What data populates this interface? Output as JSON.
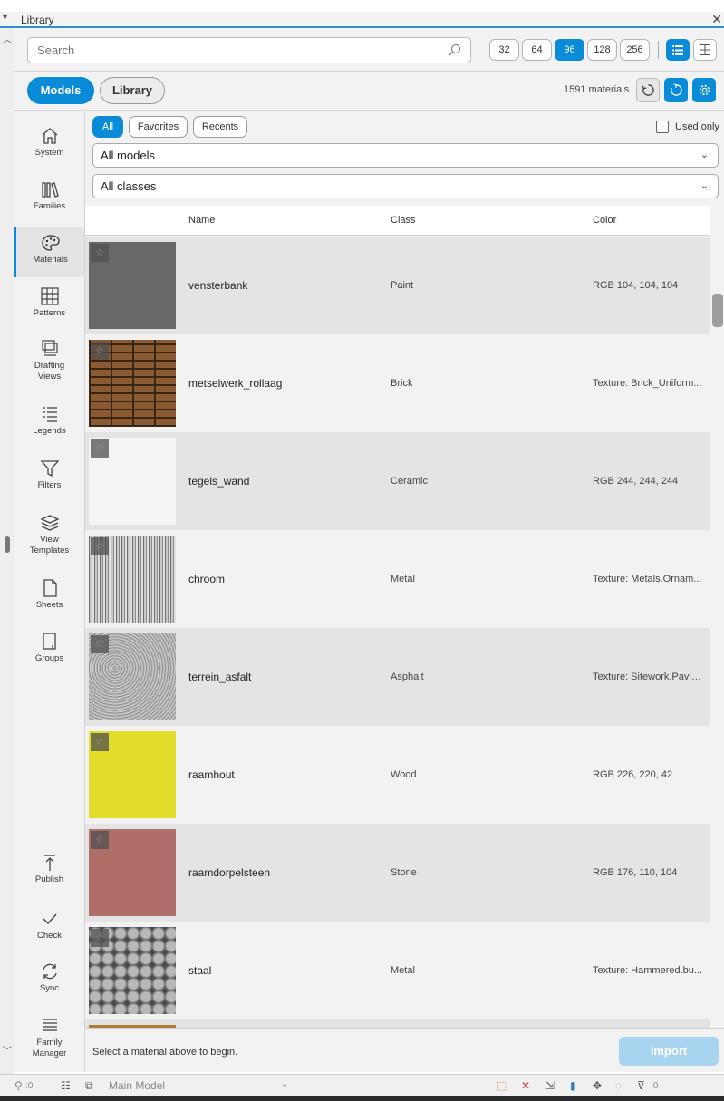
{
  "window": {
    "title": "Library",
    "close_glyph": "✕",
    "menu_glyph": "▾"
  },
  "search": {
    "placeholder": "Search",
    "value": ""
  },
  "sizes": [
    {
      "label": "32",
      "selected": false
    },
    {
      "label": "64",
      "selected": false
    },
    {
      "label": "96",
      "selected": true
    },
    {
      "label": "128",
      "selected": false
    },
    {
      "label": "256",
      "selected": false
    }
  ],
  "view_modes": [
    "list-view-icon",
    "grid-view-icon"
  ],
  "tabs": {
    "models": "Models",
    "library": "Library"
  },
  "material_count": "1591 materials",
  "sidebar": {
    "items": [
      {
        "label": "System",
        "icon": "home-icon"
      },
      {
        "label": "Families",
        "icon": "books-icon"
      },
      {
        "label": "Materials",
        "icon": "palette-icon",
        "selected": true
      },
      {
        "label": "Patterns",
        "icon": "grid-icon"
      },
      {
        "label": "Drafting Views",
        "icon": "drafting-views-icon"
      },
      {
        "label": "Legends",
        "icon": "legend-list-icon"
      },
      {
        "label": "Filters",
        "icon": "filter-icon"
      },
      {
        "label": "View Templates",
        "icon": "layers-icon"
      },
      {
        "label": "Sheets",
        "icon": "sheet-icon"
      },
      {
        "label": "Groups",
        "icon": "groups-icon"
      }
    ],
    "bottom": [
      {
        "label": "Publish",
        "icon": "publish-icon"
      },
      {
        "label": "Check",
        "icon": "check-icon"
      },
      {
        "label": "Sync",
        "icon": "sync-icon"
      },
      {
        "label": "Family Manager",
        "icon": "family-manager-icon"
      }
    ]
  },
  "filters": {
    "chips": [
      "All",
      "Favorites",
      "Recents"
    ],
    "used_only": "Used only",
    "models_dropdown": "All models",
    "classes_dropdown": "All classes"
  },
  "table": {
    "headers": {
      "name": "Name",
      "class": "Class",
      "color": "Color"
    },
    "rows": [
      {
        "name": "vensterbank",
        "class": "Paint",
        "color": "RGB 104, 104, 104",
        "swatch": "#686868",
        "texture": "none"
      },
      {
        "name": "metselwerk_rollaag",
        "class": "Brick",
        "color": "Texture: Brick_Uniform...",
        "swatch": "#8a5a32",
        "texture": "brick"
      },
      {
        "name": "tegels_wand",
        "class": "Ceramic",
        "color": "RGB 244, 244, 244",
        "swatch": "#f4f4f4",
        "texture": "none"
      },
      {
        "name": "chroom",
        "class": "Metal",
        "color": "Texture: Metals.Ornam...",
        "swatch": "#9a9a9a",
        "texture": "streak"
      },
      {
        "name": "terrein_asfalt",
        "class": "Asphalt",
        "color": "Texture: Sitework.Pavin...",
        "swatch": "#a8a8a8",
        "texture": "noise"
      },
      {
        "name": "raamhout",
        "class": "Wood",
        "color": "RGB 226, 220, 42",
        "swatch": "#e2dc2a",
        "texture": "none"
      },
      {
        "name": "raamdorpelsteen",
        "class": "Stone",
        "color": "RGB 176, 110, 104",
        "swatch": "#b06e68",
        "texture": "none"
      },
      {
        "name": "staal",
        "class": "Metal",
        "color": "Texture: Hammered.bu...",
        "swatch": "#7a7a7a",
        "texture": "hammered"
      }
    ]
  },
  "footer": {
    "message": "Select a material above to begin.",
    "import_label": "Import"
  },
  "statusbar": {
    "selection_count": ":0",
    "model": "Main Model",
    "filter_count": ":0"
  },
  "colors": {
    "accent": "#0a8bd8",
    "import_disabled": "#a9d4ef"
  }
}
